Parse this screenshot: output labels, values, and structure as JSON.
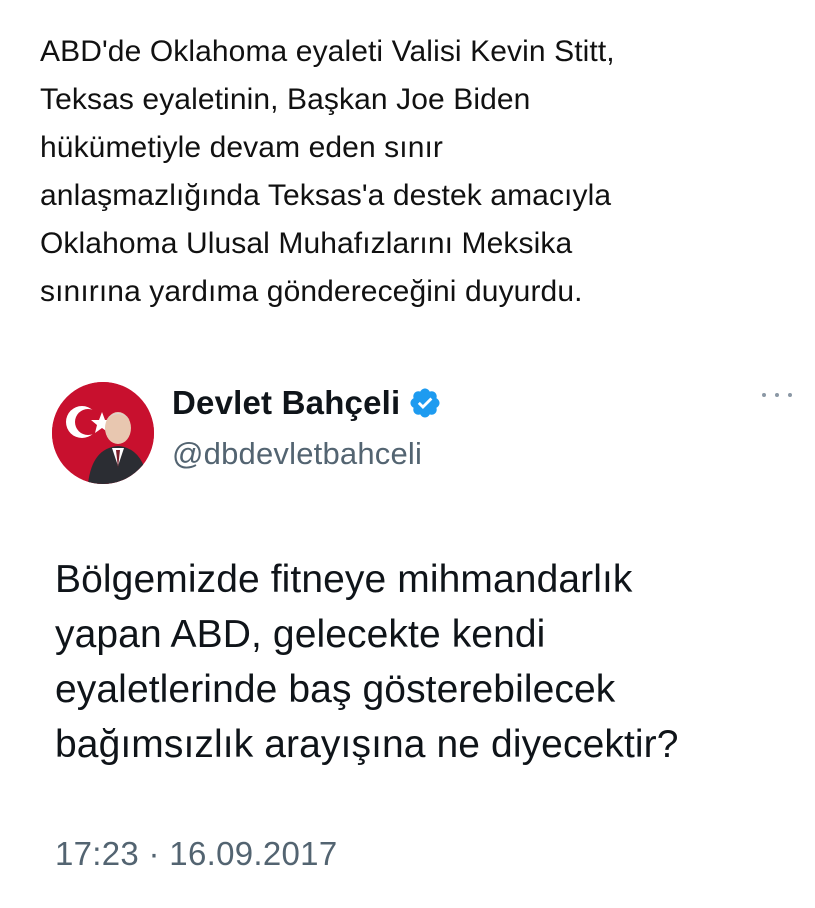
{
  "caption": {
    "text": "ABD'de Oklahoma eyaleti Valisi Kevin Stitt,\nTeksas eyaletinin, Başkan Joe Biden\nhükümetiyle devam eden sınır\nanlaşmazlığında Teksas'a destek amacıyla\nOklahoma Ulusal Muhafızlarını  Meksika\nsınırına yardıma göndereceğini duyurdu."
  },
  "tweet": {
    "display_name": "Devlet Bahçeli",
    "handle": "@dbdevletbahceli",
    "verified_icon": "verified-badge-icon",
    "more_icon": "more-options-icon",
    "text": "Bölgemizde fitneye mihmandarlık\nyapan ABD, gelecekte kendi\neyaletlerinde baş gösterebilecek\nbağımsızlık arayışına ne diyecektir?",
    "timestamp": "17:23 · 16.09.2017"
  },
  "colors": {
    "verified": "#1d9bf0",
    "secondary_text": "#536471",
    "primary_text": "#0f1419",
    "avatar_bg": "#c8102e"
  }
}
